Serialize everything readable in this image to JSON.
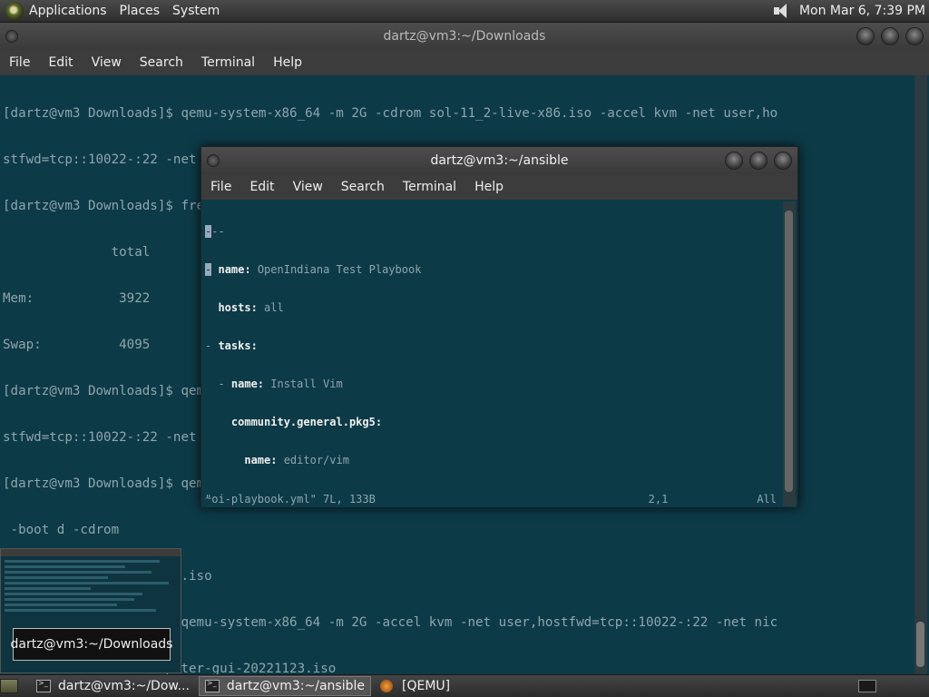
{
  "top_panel": {
    "menus": [
      "Applications",
      "Places",
      "System"
    ],
    "clock": "Mon Mar  6,  7:39 PM"
  },
  "back_window": {
    "title": "dartz@vm3:~/Downloads",
    "menu": [
      "File",
      "Edit",
      "View",
      "Search",
      "Terminal",
      "Help"
    ],
    "lines": [
      "[dartz@vm3 Downloads]$ qemu-system-x86_64 -m 2G -cdrom sol-11_2-live-x86.iso -accel kvm -net user,ho",
      "stfwd=tcp::10022-:22 -net nic -boot d",
      "[dartz@vm3 Downloads]$ free -m",
      "              total        used        free      shared  buff/cache   available",
      "Mem:           3922         369        1117          17        2444        3257",
      "Swap:          4095           0        4095",
      "[dartz@vm3 Downloads]$ qemu-system-x86_64 -m 2G -cdrom sol-11_2-live-x86.iso -accel kvm -net user,ho",
      "stfwd=tcp::10022-:22 -net nic -boot d",
      "[dartz@vm3 Downloads]$ qemu-system-x86_64 -m 2G -accel kvm -net user,hostfwd=tcp::10022-:22 -net nic",
      " -boot d -cdrom",
      "OI-hipster-gui-20221123.iso",
      "[dartz@vm3 Downloads]$ qemu-system-x86_64 -m 2G -accel kvm -net user,hostfwd=tcp::10022-:22 -net nic",
      " -boot d -cdrom OI-hipster-gui-20221123.iso"
    ]
  },
  "front_window": {
    "title": "dartz@vm3:~/ansible",
    "menu": [
      "File",
      "Edit",
      "View",
      "Search",
      "Terminal",
      "Help"
    ],
    "yaml": [
      {
        "text": "---",
        "cursor": true
      },
      {
        "key": "- name:",
        "val": " OpenIndiana Test Playbook",
        "indent": ""
      },
      {
        "key": "hosts:",
        "val": " all",
        "indent": "  "
      },
      {
        "key": "tasks:",
        "val": "",
        "indent": "  "
      },
      {
        "key": "- name:",
        "val": " Install Vim",
        "indent": "  "
      },
      {
        "key": "community.general.pkg5:",
        "val": "",
        "indent": "    "
      },
      {
        "key": "name:",
        "val": " editor/vim",
        "indent": "      "
      }
    ],
    "status_file": "\"oi-playbook.yml\" 7L, 133B",
    "status_pos": "2,1",
    "status_all": "All"
  },
  "tooltip": "dartz@vm3:~/Downloads",
  "taskbar": {
    "tasks": [
      "dartz@vm3:~/Dow...",
      "dartz@vm3:~/ansible",
      "[QEMU]"
    ]
  }
}
